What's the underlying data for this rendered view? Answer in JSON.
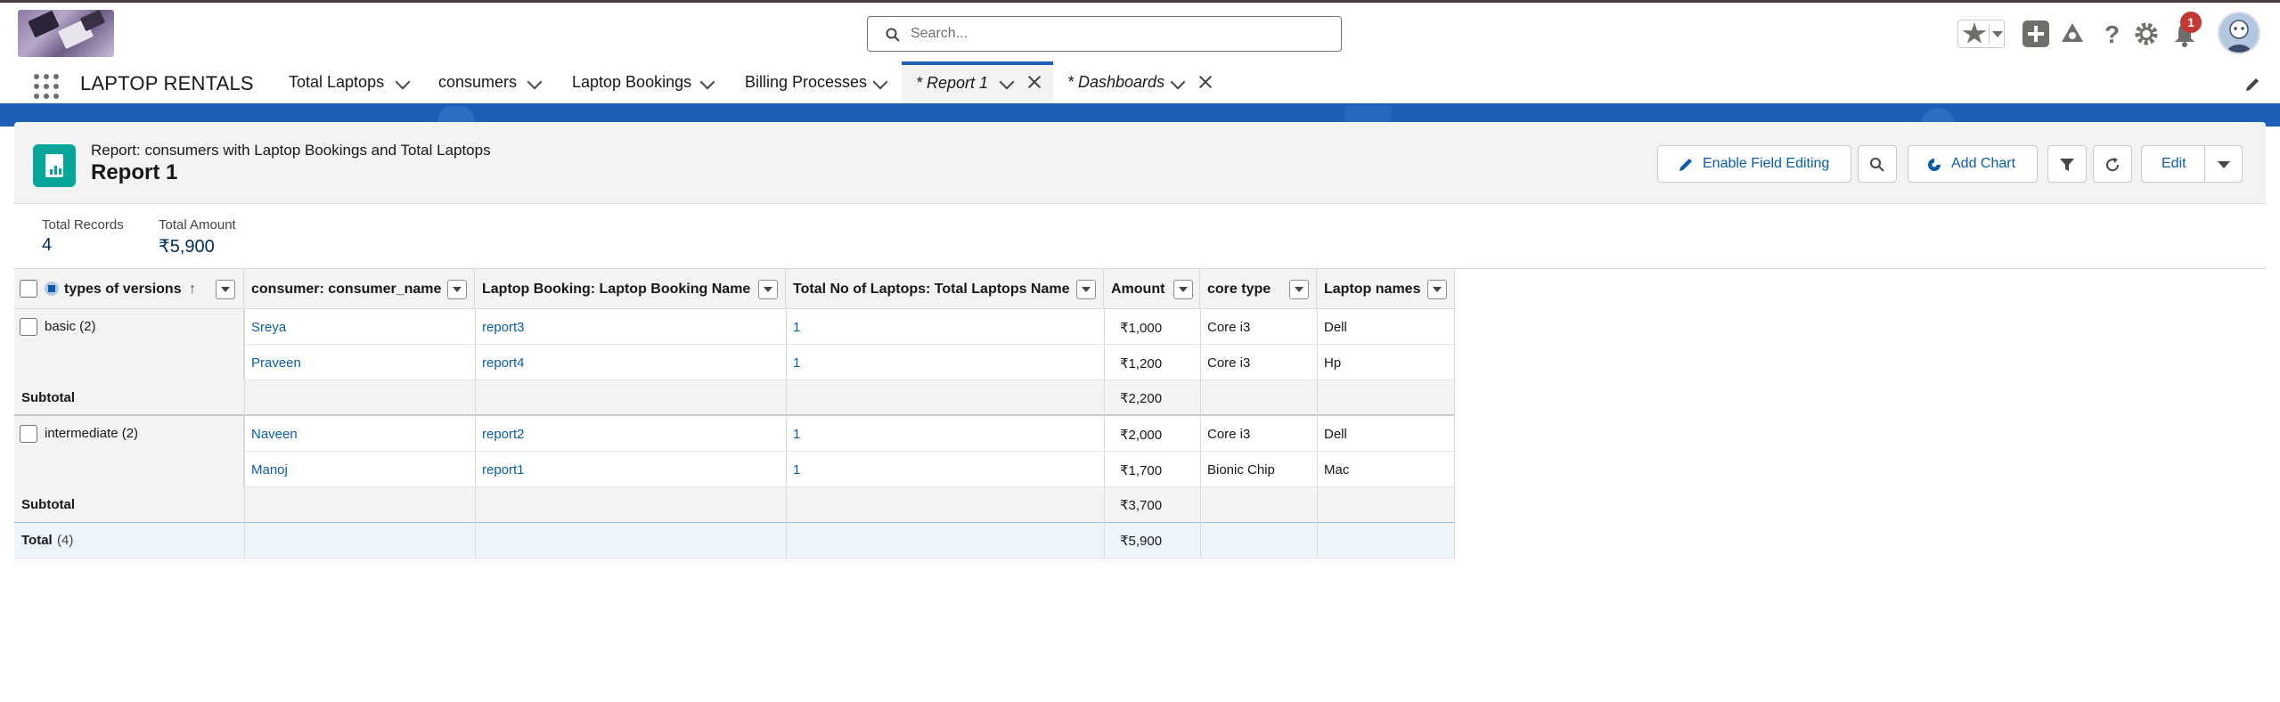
{
  "header": {
    "search_placeholder": "Search...",
    "notification_count": "1"
  },
  "nav": {
    "app_name": "LAPTOP RENTALS",
    "tabs": [
      {
        "label": "Total Laptops"
      },
      {
        "label": "consumers"
      },
      {
        "label": "Laptop Bookings"
      },
      {
        "label": "Billing Processes"
      },
      {
        "label": "* Report 1"
      },
      {
        "label": "* Dashboards"
      }
    ]
  },
  "report": {
    "subtitle": "Report: consumers with Laptop Bookings and Total Laptops",
    "title": "Report 1",
    "buttons": {
      "enable_field_editing": "Enable Field Editing",
      "add_chart": "Add Chart",
      "edit": "Edit"
    },
    "summary": {
      "total_records_label": "Total Records",
      "total_records_value": "4",
      "total_amount_label": "Total Amount",
      "total_amount_value": "₹5,900"
    }
  },
  "table": {
    "columns": [
      "types of versions",
      "consumer: consumer_name",
      "Laptop Booking: Laptop Booking Name",
      "Total No of Laptops: Total Laptops Name",
      "Amount",
      "core type",
      "Laptop names"
    ],
    "sort_indicator": "↑",
    "groups": [
      {
        "label": "basic (2)",
        "rows": [
          [
            "Sreya",
            "report3",
            "1",
            "₹1,000",
            "Core i3",
            "Dell"
          ],
          [
            "Praveen",
            "report4",
            "1",
            "₹1,200",
            "Core i3",
            "Hp"
          ]
        ],
        "subtotal_label": "Subtotal",
        "subtotal_amount": "₹2,200"
      },
      {
        "label": "intermediate (2)",
        "rows": [
          [
            "Naveen",
            "report2",
            "1",
            "₹2,000",
            "Core i3",
            "Dell"
          ],
          [
            "Manoj",
            "report1",
            "1",
            "₹1,700",
            "Bionic Chip",
            "Mac"
          ]
        ],
        "subtotal_label": "Subtotal",
        "subtotal_amount": "₹3,700"
      }
    ],
    "total_label": "Total",
    "total_count": "(4)",
    "total_amount": "₹5,900"
  }
}
